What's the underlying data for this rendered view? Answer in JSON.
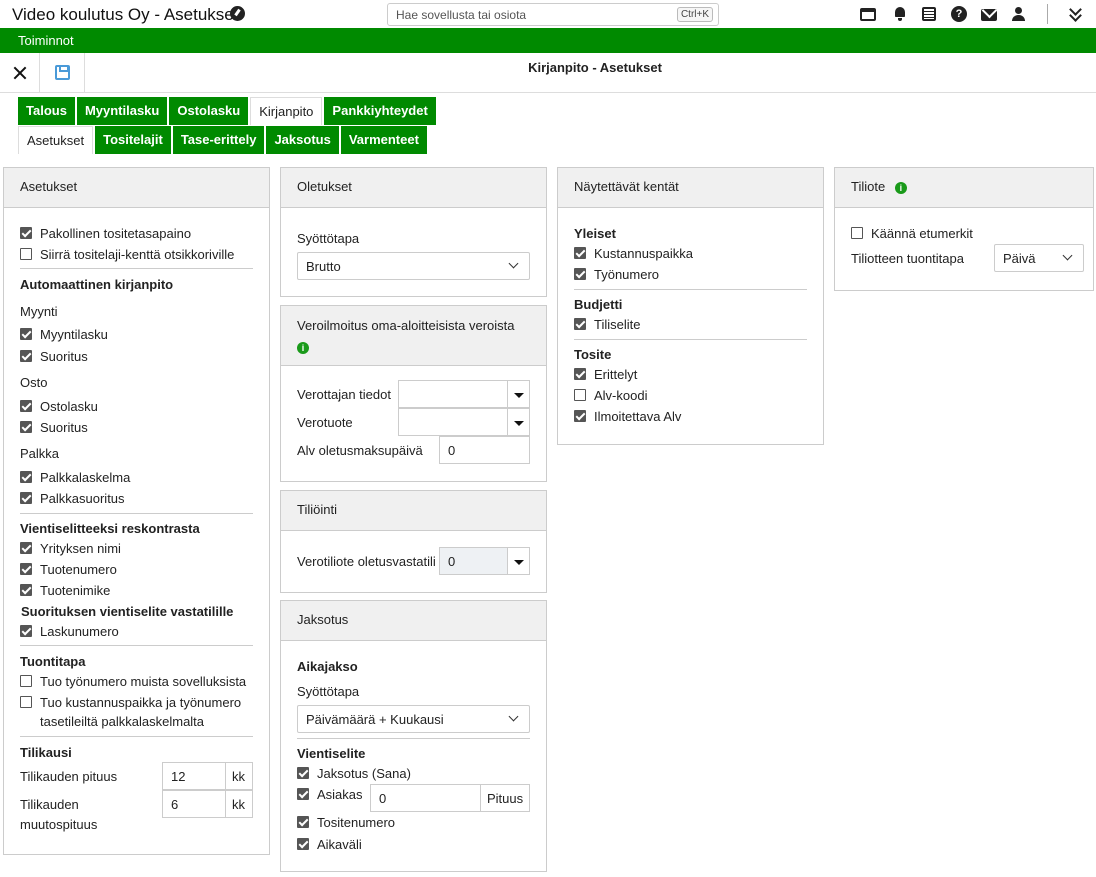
{
  "app": {
    "title": "Video koulutus Oy - Asetukset",
    "search_placeholder": "Hae sovellusta tai osiota",
    "search_shortcut": "Ctrl+K"
  },
  "menu": {
    "label": "Toiminnot"
  },
  "page": {
    "title": "Kirjanpito - Asetukset"
  },
  "tabs_main": [
    "Talous",
    "Myyntilasku",
    "Ostolasku",
    "Kirjanpito",
    "Pankkiyhteydet"
  ],
  "tabs_sub": [
    "Asetukset",
    "Tositelajit",
    "Tase-erittely",
    "Jaksotus",
    "Varmenteet"
  ],
  "asetukset": {
    "title": "Asetukset",
    "pakollinen": "Pakollinen tositetasapaino",
    "siirra": "Siirrä tositelaji-kenttä otsikkoriville",
    "auto_heading": "Automaattinen kirjanpito",
    "myynti": "Myynti",
    "myyntilasku": "Myyntilasku",
    "suoritus1": "Suoritus",
    "osto": "Osto",
    "ostolasku": "Ostolasku",
    "suoritus2": "Suoritus",
    "palkka": "Palkka",
    "palkkalaskelma": "Palkkalaskelma",
    "palkkasuoritus": "Palkkasuoritus",
    "vientiselite_heading": "Vientiselitteeksi reskontrasta",
    "yrityksen_nimi": "Yrityksen nimi",
    "tuotenumero": "Tuotenumero",
    "tuotenimike": "Tuotenimike",
    "suoritus_heading": "Suorituksen vientiselite vastatilille",
    "laskunumero": "Laskunumero",
    "tuontitapa_heading": "Tuontitapa",
    "tuo_tyonumero": "Tuo työnumero muista sovelluksista",
    "tuo_kp_1": "Tuo kustannuspaikka ja työnumero",
    "tuo_kp_2": "tasetileiltä palkkalaskelmalta",
    "tilikausi_heading": "Tilikausi",
    "tilikauden_pituus": "Tilikauden pituus",
    "pituus_value": "12",
    "kk1": "kk",
    "muutos_1": "Tilikauden",
    "muutos_2": "muutospituus",
    "muutos_value": "6",
    "kk2": "kk"
  },
  "oletukset": {
    "title": "Oletukset",
    "syottotapa_label": "Syöttötapa",
    "syottotapa_value": "Brutto"
  },
  "veroilmoitus": {
    "title": "Veroilmoitus oma-aloitteisista veroista",
    "verottajan": "Verottajan tiedot",
    "verotuote": "Verotuote",
    "alv_label": "Alv oletusmaksupäivä",
    "alv_value": "0"
  },
  "tiliointi": {
    "title": "Tiliöinti",
    "label": "Verotiliote oletusvastatili",
    "value": "0"
  },
  "jaksotus": {
    "title": "Jaksotus",
    "aikajakso": "Aikajakso",
    "syottotapa_label": "Syöttötapa",
    "syottotapa_value": "Päivämäärä + Kuukausi",
    "vientiselite": "Vientiselite",
    "jaksotus_sana": "Jaksotus (Sana)",
    "asiakas": "Asiakas",
    "asiakas_value": "0",
    "pituus": "Pituus",
    "tositenumero": "Tositenumero",
    "aikavali": "Aikaväli"
  },
  "naytettavat": {
    "title": "Näytettävät kentät",
    "yleiset": "Yleiset",
    "kustannuspaikka": "Kustannuspaikka",
    "tyonumero": "Työnumero",
    "budjetti": "Budjetti",
    "tiliselite": "Tiliselite",
    "tosite": "Tosite",
    "erittelyt": "Erittelyt",
    "alv_koodi": "Alv-koodi",
    "ilmoitettava_alv": "Ilmoitettava Alv"
  },
  "tiliote": {
    "title": "Tiliote",
    "kaanna": "Käännä etumerkit",
    "tuontitapa_label": "Tiliotteen tuontitapa",
    "tuontitapa_value": "Päivä"
  },
  "colors": {
    "accent": "#008a00",
    "info": "#1a9a1a"
  }
}
